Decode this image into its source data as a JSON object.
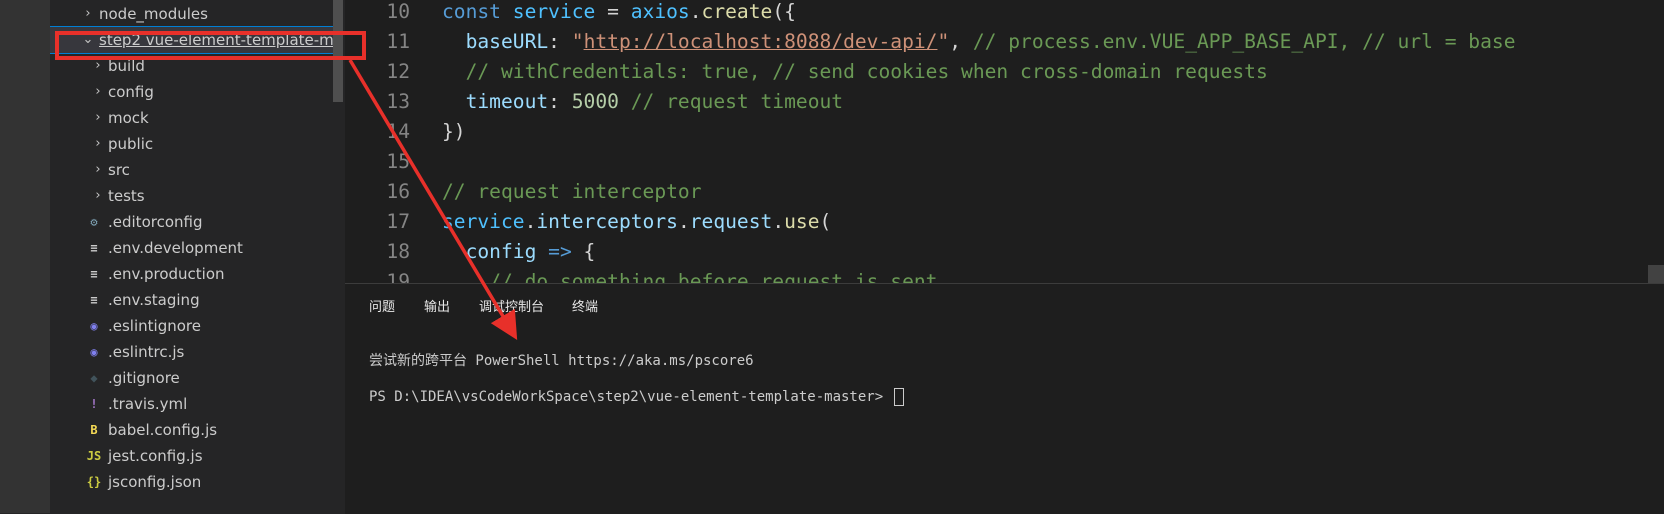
{
  "explorer": {
    "items": [
      {
        "label": "node_modules",
        "type": "folder",
        "expanded": false
      },
      {
        "label_prefix": "step2",
        "label_rest": "vue-element-template-mas...",
        "type": "folder",
        "expanded": true,
        "selected": true
      },
      {
        "label": "build",
        "type": "folder",
        "expanded": false
      },
      {
        "label": "config",
        "type": "folder",
        "expanded": false
      },
      {
        "label": "mock",
        "type": "folder",
        "expanded": false
      },
      {
        "label": "public",
        "type": "folder",
        "expanded": false
      },
      {
        "label": "src",
        "type": "folder",
        "expanded": false
      },
      {
        "label": "tests",
        "type": "folder",
        "expanded": false
      },
      {
        "label": ".editorconfig",
        "icon": "gear-icon"
      },
      {
        "label": ".env.development",
        "icon": "lines-icon"
      },
      {
        "label": ".env.production",
        "icon": "lines-icon"
      },
      {
        "label": ".env.staging",
        "icon": "lines-icon"
      },
      {
        "label": ".eslintignore",
        "icon": "eslint-icon"
      },
      {
        "label": ".eslintrc.js",
        "icon": "eslint-icon"
      },
      {
        "label": ".gitignore",
        "icon": "git-icon"
      },
      {
        "label": ".travis.yml",
        "icon": "exclamation-icon"
      },
      {
        "label": "babel.config.js",
        "icon": "babel-icon"
      },
      {
        "label": "jest.config.js",
        "icon": "js-icon"
      },
      {
        "label": "jsconfig.json",
        "icon": "json-icon"
      }
    ]
  },
  "editor": {
    "lines": [
      {
        "num": "10",
        "tokens": [
          [
            "kw",
            "const "
          ],
          [
            "var",
            "service"
          ],
          [
            "punc",
            " = "
          ],
          [
            "var",
            "axios"
          ],
          [
            "punc",
            "."
          ],
          [
            "fn",
            "create"
          ],
          [
            "punc",
            "({"
          ]
        ]
      },
      {
        "num": "11",
        "tokens": [
          [
            "punc",
            "  "
          ],
          [
            "prop",
            "baseURL"
          ],
          [
            "punc",
            ": "
          ],
          [
            "str",
            "\""
          ],
          [
            "link",
            "http://localhost:8088/dev-api/"
          ],
          [
            "str",
            "\""
          ],
          [
            "punc",
            ", "
          ],
          [
            "cmt",
            "// process.env.VUE_APP_BASE_API, // url = base"
          ]
        ]
      },
      {
        "num": "12",
        "tokens": [
          [
            "punc",
            "  "
          ],
          [
            "cmt",
            "// withCredentials: true, // send cookies when cross-domain requests"
          ]
        ]
      },
      {
        "num": "13",
        "tokens": [
          [
            "punc",
            "  "
          ],
          [
            "prop",
            "timeout"
          ],
          [
            "punc",
            ": "
          ],
          [
            "num",
            "5000"
          ],
          [
            "punc",
            " "
          ],
          [
            "cmt",
            "// request timeout"
          ]
        ]
      },
      {
        "num": "14",
        "tokens": [
          [
            "punc",
            "})"
          ]
        ]
      },
      {
        "num": "15",
        "tokens": []
      },
      {
        "num": "16",
        "tokens": [
          [
            "cmt",
            "// request interceptor"
          ]
        ]
      },
      {
        "num": "17",
        "tokens": [
          [
            "var",
            "service"
          ],
          [
            "punc",
            "."
          ],
          [
            "prop",
            "interceptors"
          ],
          [
            "punc",
            "."
          ],
          [
            "prop",
            "request"
          ],
          [
            "punc",
            "."
          ],
          [
            "fn",
            "use"
          ],
          [
            "punc",
            "("
          ]
        ]
      },
      {
        "num": "18",
        "tokens": [
          [
            "punc",
            "  "
          ],
          [
            "prop",
            "config"
          ],
          [
            "punc",
            " "
          ],
          [
            "kw",
            "=>"
          ],
          [
            "punc",
            " {"
          ]
        ]
      },
      {
        "num": "19",
        "tokens": [
          [
            "punc",
            "    "
          ],
          [
            "cmt",
            "// do something before request is sent"
          ]
        ]
      }
    ]
  },
  "panel": {
    "tabs": [
      "问题",
      "输出",
      "调试控制台",
      "终端"
    ],
    "terminal": {
      "line1": "尝试新的跨平台 PowerShell https://aka.ms/pscore6",
      "prompt": "PS D:\\IDEA\\vsCodeWorkSpace\\step2\\vue-element-template-master>"
    }
  },
  "colors": {
    "annotation": "#e8302a",
    "keyword": "#569cd6",
    "comment": "#6a9955",
    "string": "#ce9178"
  }
}
